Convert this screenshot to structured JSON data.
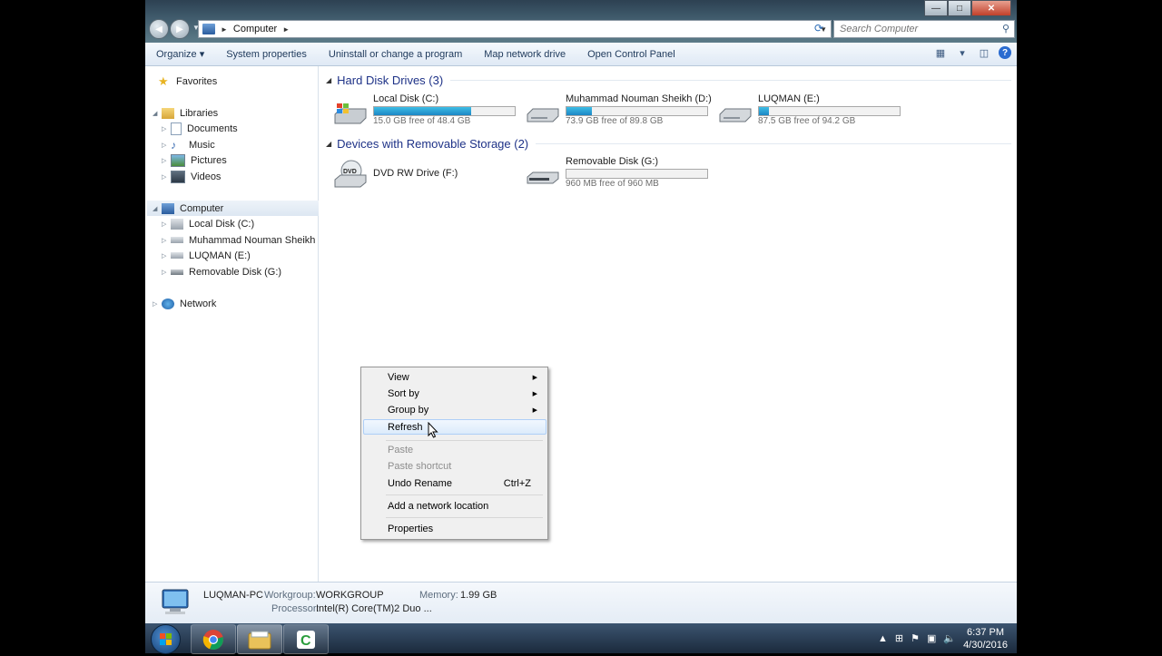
{
  "window": {
    "buttons": {
      "minimize": "—",
      "maximize": "□",
      "close": "✕"
    },
    "address": {
      "crumb": "Computer",
      "sep_icon": "►"
    },
    "search": {
      "placeholder": "Search Computer"
    }
  },
  "toolbar": {
    "organize": "Organize ▾",
    "system_properties": "System properties",
    "uninstall": "Uninstall or change a program",
    "map_drive": "Map network drive",
    "control_panel": "Open Control Panel"
  },
  "navpane": {
    "favorites": "Favorites",
    "libraries": "Libraries",
    "documents": "Documents",
    "music": "Music",
    "pictures": "Pictures",
    "videos": "Videos",
    "computer": "Computer",
    "local_disk": "Local Disk (C:)",
    "muhammad": "Muhammad Nouman Sheikh (D:)",
    "luqman": "LUQMAN (E:)",
    "removable": "Removable Disk (G:)",
    "network": "Network"
  },
  "content": {
    "hard_disk_header": "Hard Disk Drives (3)",
    "removable_header": "Devices with Removable Storage (2)",
    "drives": [
      {
        "name": "Local Disk (C:)",
        "free": "15.0 GB free of 48.4 GB",
        "used_fraction": 0.69
      },
      {
        "name": "Muhammad Nouman Sheikh (D:)",
        "free": "73.9 GB free of 89.8 GB",
        "used_fraction": 0.18
      },
      {
        "name": "LUQMAN (E:)",
        "free": "87.5 GB free of 94.2 GB",
        "used_fraction": 0.07
      }
    ],
    "removable": [
      {
        "name": "DVD RW Drive (F:)"
      },
      {
        "name": "Removable Disk (G:)",
        "free": "960 MB free of 960 MB",
        "used_fraction": 0.0
      }
    ]
  },
  "context_menu": {
    "view": "View",
    "sort_by": "Sort by",
    "group_by": "Group by",
    "refresh": "Refresh",
    "paste": "Paste",
    "paste_shortcut": "Paste shortcut",
    "undo_rename": "Undo Rename",
    "undo_shortcut": "Ctrl+Z",
    "add_network": "Add a network location",
    "properties": "Properties"
  },
  "details": {
    "pc_name": "LUQMAN-PC",
    "workgroup_label": "Workgroup:",
    "workgroup_value": "WORKGROUP",
    "memory_label": "Memory:",
    "memory_value": "1.99 GB",
    "processor_label": "Processor:",
    "processor_value": "Intel(R) Core(TM)2 Duo ..."
  },
  "taskbar": {
    "time": "6:37 PM",
    "date": "4/30/2016"
  },
  "colors": {
    "drive_bar_fill": "#26a0da",
    "group_header": "#1e3287"
  }
}
